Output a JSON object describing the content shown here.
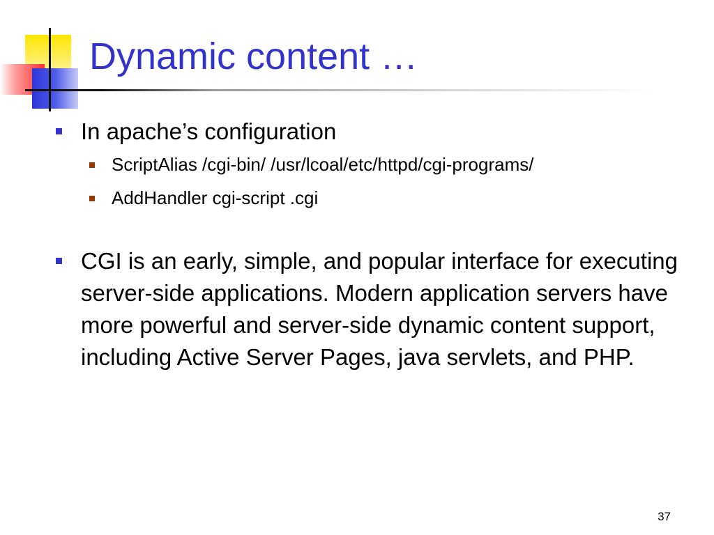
{
  "slide": {
    "title": "Dynamic content …",
    "page_number": "37",
    "bullets": [
      {
        "text": "In apache’s configuration",
        "sub": [
          "ScriptAlias /cgi-bin/ /usr/lcoal/etc/httpd/cgi-programs/",
          "AddHandler cgi-script .cgi"
        ]
      },
      {
        "text": "CGI is an early, simple, and popular interface for executing server-side applications. Modern application servers have more powerful and server-side dynamic content support, including Active Server Pages, java servlets, and PHP."
      }
    ]
  },
  "colors": {
    "title": "#3333cc",
    "level1_bullet": "#3333cc",
    "level2_bullet": "#993300",
    "accent_yellow": "#ffe600",
    "accent_red": "#ff3030",
    "accent_blue": "#2c36d8"
  }
}
